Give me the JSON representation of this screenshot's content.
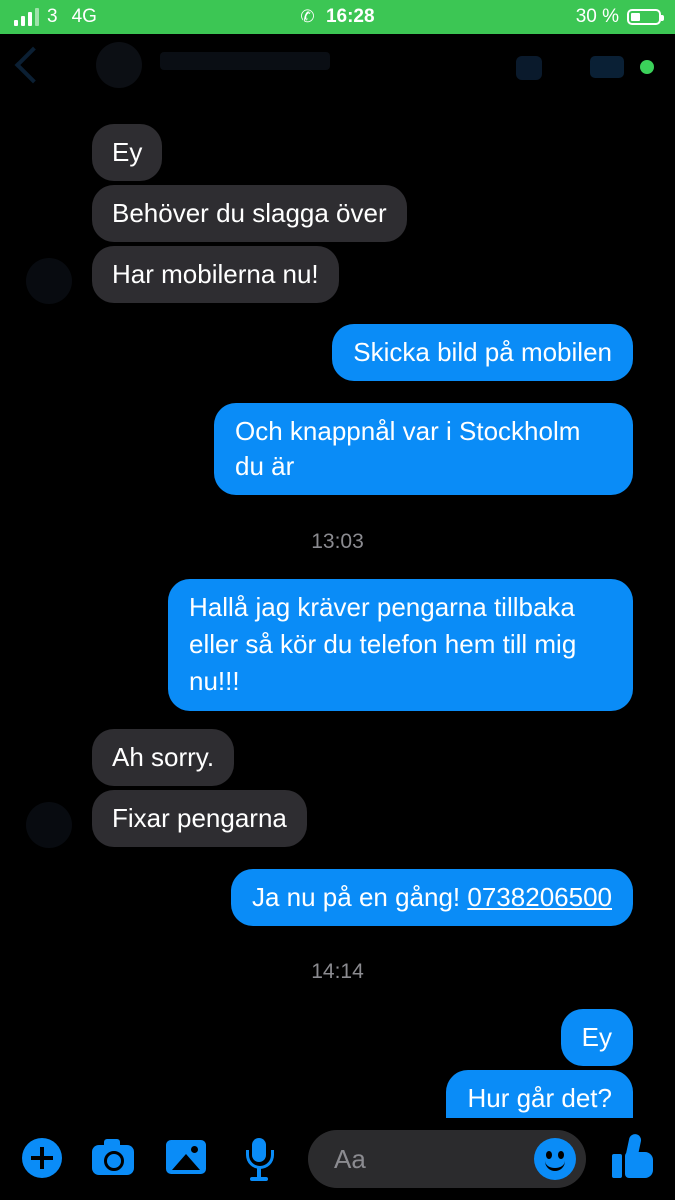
{
  "status_bar": {
    "carrier": "3",
    "network": "4G",
    "time": "16:28",
    "battery_text": "30 %",
    "battery_level": 0.3,
    "background_color": "#3cc654"
  },
  "messages": [
    {
      "direction": "incoming",
      "text": "Ey"
    },
    {
      "direction": "incoming",
      "text": "Behöver du slagga över"
    },
    {
      "direction": "incoming",
      "text": "Har mobilerna nu!"
    },
    {
      "direction": "outgoing",
      "text": "Skicka bild på mobilen"
    },
    {
      "direction": "outgoing",
      "text": "Och knappnål var i Stockholm du är"
    },
    {
      "direction": "timestamp",
      "text": "13:03"
    },
    {
      "direction": "outgoing",
      "text": "Hallå jag kräver pengarna tillbaka eller så kör du telefon hem till mig nu!!!"
    },
    {
      "direction": "incoming",
      "text": "Ah sorry."
    },
    {
      "direction": "incoming",
      "text": "Fixar pengarna"
    },
    {
      "direction": "outgoing",
      "text": "Ja nu på en gång!",
      "link": "0738206500"
    },
    {
      "direction": "timestamp",
      "text": "14:14"
    },
    {
      "direction": "outgoing",
      "text": "Ey"
    },
    {
      "direction": "outgoing",
      "text": "Hur går det?"
    }
  ],
  "composer": {
    "placeholder": "Aa"
  },
  "colors": {
    "outgoing_bubble": "#0a8cf7",
    "incoming_bubble": "#2e2d31",
    "accent": "#0a8cf7",
    "background": "#000000"
  }
}
